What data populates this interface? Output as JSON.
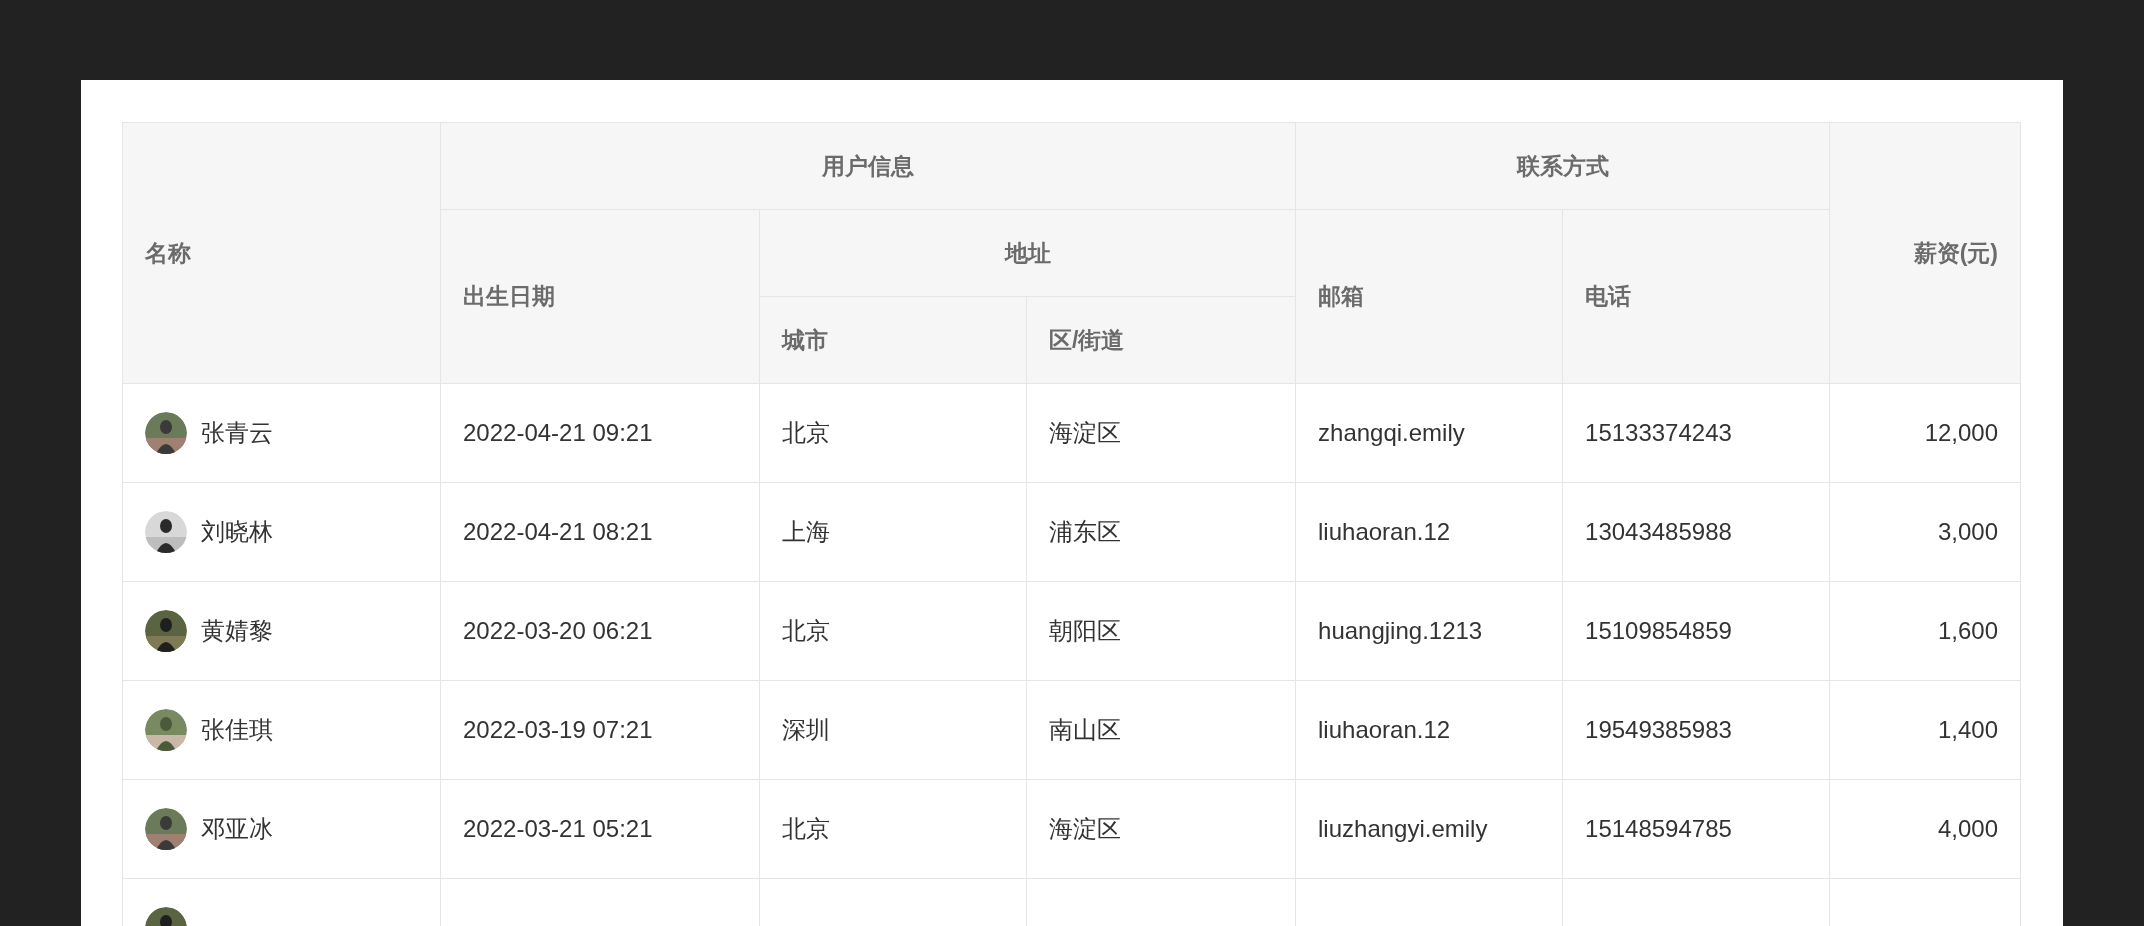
{
  "table": {
    "columns": [
      {
        "label": "名称"
      },
      {
        "label": "用户信息",
        "colspan": 3,
        "children": [
          {
            "label": "出生日期"
          },
          {
            "label": "地址",
            "colspan": 2,
            "children": [
              {
                "label": "城市"
              },
              {
                "label": "区/街道"
              }
            ]
          }
        ]
      },
      {
        "label": "联系方式",
        "colspan": 2,
        "children": [
          {
            "label": "邮箱"
          },
          {
            "label": "电话"
          }
        ]
      },
      {
        "label": "薪资(元)"
      }
    ],
    "rows": [
      {
        "cells": [
          "张青云",
          "2022-04-21 09:21",
          "北京",
          "海淀区",
          "zhangqi.emily",
          "15133374243",
          "12,000"
        ]
      },
      {
        "cells": [
          "刘晓林",
          "2022-04-21 08:21",
          "上海",
          "浦东区",
          "liuhaoran.12",
          "13043485988",
          "3,000"
        ]
      },
      {
        "cells": [
          "黄婧黎",
          "2022-03-20 06:21",
          "北京",
          "朝阳区",
          "huangjing.1213",
          "15109854859",
          "1,600"
        ]
      },
      {
        "cells": [
          "张佳琪",
          "2022-03-19 07:21",
          "深圳",
          "南山区",
          "liuhaoran.12",
          "19549385983",
          "1,400"
        ]
      },
      {
        "cells": [
          "邓亚冰",
          "2022-03-21 05:21",
          "北京",
          "海淀区",
          "liuzhangyi.emily",
          "15148594785",
          "4,000"
        ]
      }
    ]
  }
}
